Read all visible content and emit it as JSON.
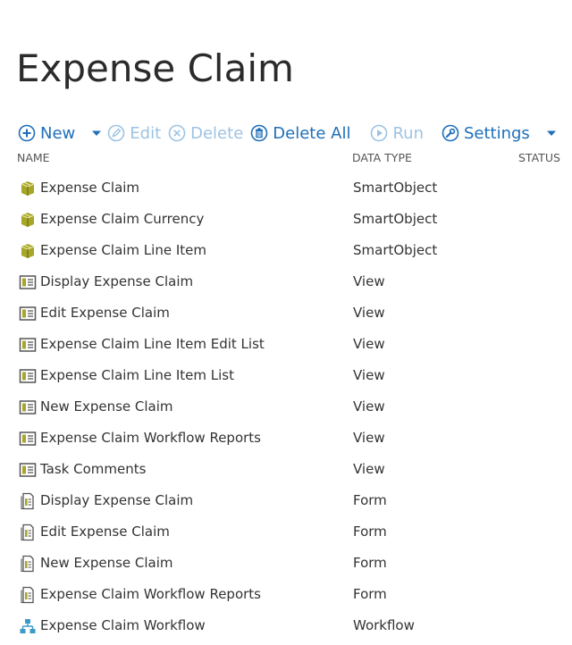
{
  "page": {
    "title": "Expense Claim"
  },
  "toolbar": {
    "new_label": "New",
    "edit_label": "Edit",
    "delete_label": "Delete",
    "delete_all_label": "Delete All",
    "run_label": "Run",
    "settings_label": "Settings"
  },
  "columns": {
    "name": "NAME",
    "data_type": "DATA TYPE",
    "status": "STATUS"
  },
  "colors": {
    "accent": "#1e6fb8",
    "disabled": "#9dc3e3",
    "smartobject": "#9a9a1e",
    "view": "#7a7a14",
    "workflow": "#3a9bc8"
  },
  "rows": [
    {
      "icon": "smartobject-icon",
      "name": "Expense Claim",
      "type": "SmartObject"
    },
    {
      "icon": "smartobject-icon",
      "name": "Expense Claim Currency",
      "type": "SmartObject"
    },
    {
      "icon": "smartobject-icon",
      "name": "Expense Claim Line Item",
      "type": "SmartObject"
    },
    {
      "icon": "view-icon",
      "name": "Display Expense Claim",
      "type": "View"
    },
    {
      "icon": "view-icon",
      "name": "Edit Expense Claim",
      "type": "View"
    },
    {
      "icon": "view-icon",
      "name": "Expense Claim Line Item Edit List",
      "type": "View"
    },
    {
      "icon": "view-icon",
      "name": "Expense Claim Line Item List",
      "type": "View"
    },
    {
      "icon": "view-icon",
      "name": "New Expense Claim",
      "type": "View"
    },
    {
      "icon": "view-icon",
      "name": "Expense Claim Workflow Reports",
      "type": "View"
    },
    {
      "icon": "view-icon",
      "name": "Task Comments",
      "type": "View"
    },
    {
      "icon": "form-icon",
      "name": "Display Expense Claim",
      "type": "Form"
    },
    {
      "icon": "form-icon",
      "name": "Edit Expense Claim",
      "type": "Form"
    },
    {
      "icon": "form-icon",
      "name": "New Expense Claim",
      "type": "Form"
    },
    {
      "icon": "form-icon",
      "name": "Expense Claim Workflow Reports",
      "type": "Form"
    },
    {
      "icon": "workflow-icon",
      "name": "Expense Claim Workflow",
      "type": "Workflow"
    }
  ]
}
